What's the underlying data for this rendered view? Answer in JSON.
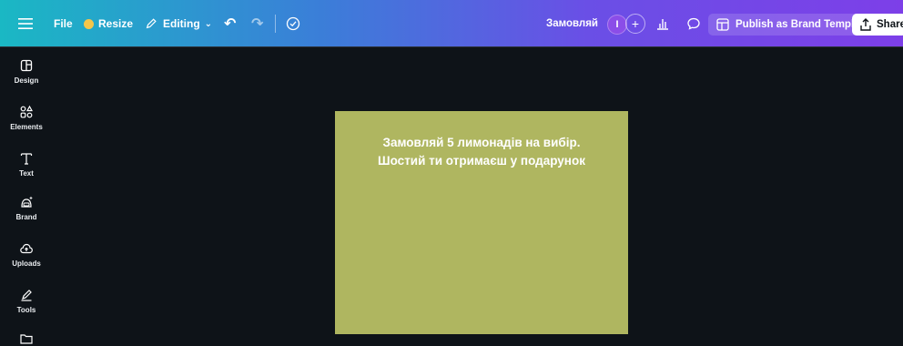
{
  "topbar": {
    "file_label": "File",
    "resize_label": "Resize",
    "editing_label": "Editing",
    "doc_title": "Замовляй",
    "avatar_initial": "I",
    "publish_label": "Publish as Brand Template",
    "share_label": "Share",
    "icons": [
      "menu-icon",
      "undo-icon",
      "redo-icon",
      "cloud-check-icon",
      "plus-icon",
      "analytics-icon",
      "comment-icon",
      "brand-template-icon",
      "share-icon"
    ]
  },
  "sidebar": {
    "items": [
      {
        "label": "Design",
        "icon": "design-icon"
      },
      {
        "label": "Elements",
        "icon": "elements-icon"
      },
      {
        "label": "Text",
        "icon": "text-icon"
      },
      {
        "label": "Brand",
        "icon": "brand-icon"
      },
      {
        "label": "Uploads",
        "icon": "uploads-icon"
      },
      {
        "label": "Tools",
        "icon": "tools-icon"
      }
    ]
  },
  "canvas": {
    "background": "#afb660",
    "text_line1": "Замовляй 5 лимонадів на вибір.",
    "text_line2": "Шостий ти отримаєш у подарунок"
  },
  "colors": {
    "gradient_start": "#1ab8c4",
    "gradient_end": "#7d3fe8",
    "app_background": "#0e1318",
    "resize_dot": "#f6c64a"
  }
}
